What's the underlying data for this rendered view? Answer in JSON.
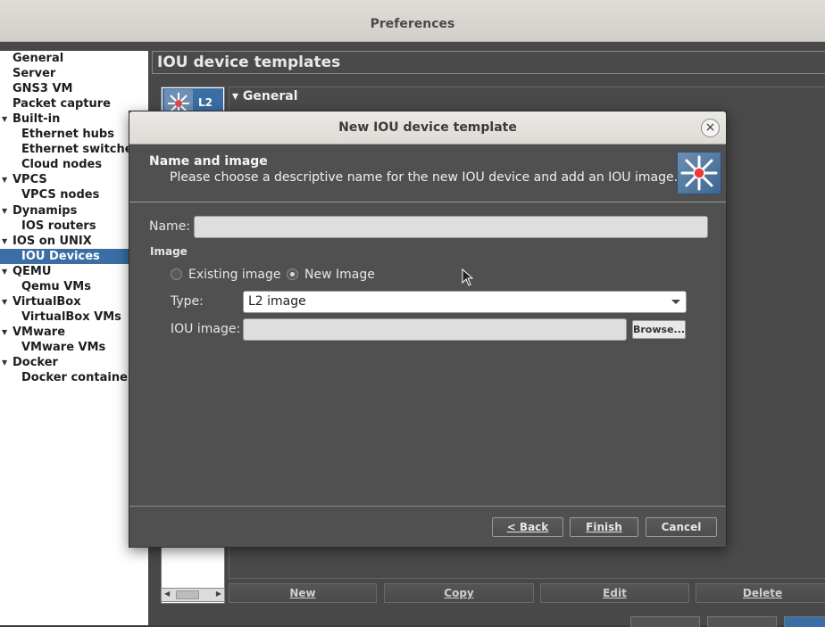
{
  "window": {
    "title": "Preferences"
  },
  "tree": {
    "items": [
      {
        "label": "General",
        "expandable": false,
        "indent": 0
      },
      {
        "label": "Server",
        "expandable": false,
        "indent": 0
      },
      {
        "label": "GNS3 VM",
        "expandable": false,
        "indent": 0
      },
      {
        "label": "Packet capture",
        "expandable": false,
        "indent": 0
      },
      {
        "label": "Built-in",
        "expandable": true,
        "indent": 0
      },
      {
        "label": "Ethernet hubs",
        "expandable": false,
        "indent": 1
      },
      {
        "label": "Ethernet switches",
        "expandable": false,
        "indent": 1
      },
      {
        "label": "Cloud nodes",
        "expandable": false,
        "indent": 1
      },
      {
        "label": "VPCS",
        "expandable": true,
        "indent": 0
      },
      {
        "label": "VPCS nodes",
        "expandable": false,
        "indent": 1
      },
      {
        "label": "Dynamips",
        "expandable": true,
        "indent": 0
      },
      {
        "label": "IOS routers",
        "expandable": false,
        "indent": 1
      },
      {
        "label": "IOS on UNIX",
        "expandable": true,
        "indent": 0
      },
      {
        "label": "IOU Devices",
        "expandable": false,
        "indent": 1,
        "selected": true
      },
      {
        "label": "QEMU",
        "expandable": true,
        "indent": 0
      },
      {
        "label": "Qemu VMs",
        "expandable": false,
        "indent": 1
      },
      {
        "label": "VirtualBox",
        "expandable": true,
        "indent": 0
      },
      {
        "label": "VirtualBox VMs",
        "expandable": false,
        "indent": 1
      },
      {
        "label": "VMware",
        "expandable": true,
        "indent": 0
      },
      {
        "label": "VMware VMs",
        "expandable": false,
        "indent": 1
      },
      {
        "label": "Docker",
        "expandable": true,
        "indent": 0
      },
      {
        "label": "Docker containers",
        "expandable": false,
        "indent": 1
      }
    ]
  },
  "page": {
    "title": "IOU device templates",
    "template_item_label": "L2",
    "details_header": "General",
    "buttons": {
      "new": "New",
      "copy": "Copy",
      "edit": "Edit",
      "delete": "Delete"
    }
  },
  "dialog": {
    "title": "New IOU device template",
    "header_title": "Name and image",
    "header_subtitle": "Please choose a descriptive name for the new IOU device and add an IOU image.",
    "name_label": "Name:",
    "name_value": "",
    "image_group": "Image",
    "radio_existing": "Existing image",
    "radio_new": "New Image",
    "radio_selected": "new",
    "type_label": "Type:",
    "type_value": "L2 image",
    "iou_image_label": "IOU image:",
    "iou_image_value": "",
    "browse_label": "Browse...",
    "back_label": "< Back",
    "finish_label": "Finish",
    "cancel_label": "Cancel",
    "close_icon": "×"
  },
  "colors": {
    "selection": "#3a6ea5",
    "panel": "#505050",
    "logo": "#4e77a3"
  }
}
